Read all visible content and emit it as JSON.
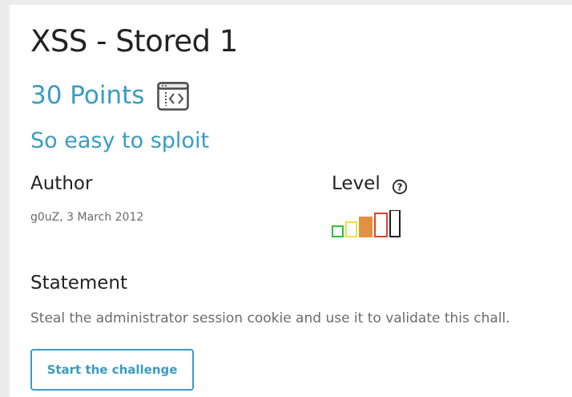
{
  "challenge": {
    "title": "XSS - Stored 1",
    "points": "30 Points",
    "category_icon": "web-client-icon",
    "subtitle": "So easy to sploit"
  },
  "author": {
    "label": "Author",
    "info": "g0uZ,  3 March 2012"
  },
  "level": {
    "label": "Level",
    "help_icon": "question-circle-icon",
    "value": 3,
    "max": 5,
    "colors": [
      "#2fbf3a",
      "#e8e53a",
      "#e2913f",
      "#d8472a",
      "#1f1f1f"
    ]
  },
  "statement": {
    "label": "Statement",
    "text": "Steal the administrator session cookie and use it to validate this chall."
  },
  "actions": {
    "start_label": "Start the challenge"
  },
  "colors": {
    "accent": "#3a9cc0",
    "text": "#222222",
    "muted": "#6b6b6b"
  }
}
